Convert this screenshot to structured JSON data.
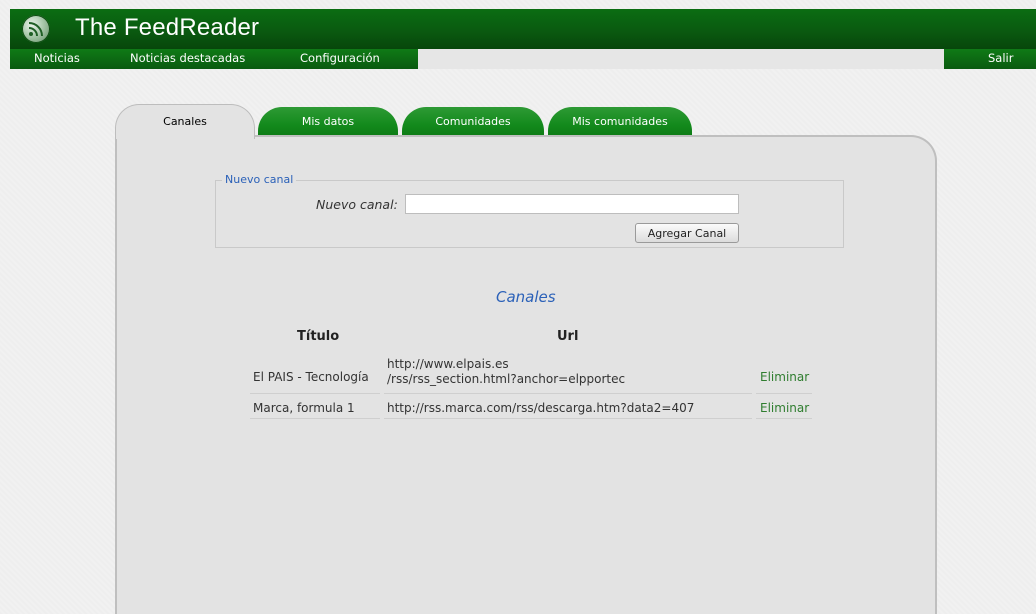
{
  "app": {
    "title": "The FeedReader",
    "logo_icon": "rss-icon"
  },
  "nav": {
    "items": [
      "Noticias",
      "Noticias destacadas",
      "Configuración"
    ],
    "logout": "Salir"
  },
  "tabs": [
    {
      "label": "Canales",
      "active": true
    },
    {
      "label": "Mis datos",
      "active": false
    },
    {
      "label": "Comunidades",
      "active": false
    },
    {
      "label": "Mis comunidades",
      "active": false
    }
  ],
  "form": {
    "legend": "Nuevo canal",
    "field_label": "Nuevo canal:",
    "field_value": "",
    "button_label": "Agregar Canal"
  },
  "channels": {
    "title": "Canales",
    "columns": [
      "Título",
      "Url"
    ],
    "rows": [
      {
        "title": "El PAIS - Tecnología",
        "url_line1": "http://www.elpais.es",
        "url_line2": "/rss/rss_section.html?anchor=elpportec",
        "action": "Eliminar"
      },
      {
        "title": "Marca, formula 1",
        "url_line1": "http://rss.marca.com/rss/descarga.htm?data2=407",
        "url_line2": "",
        "action": "Eliminar"
      }
    ]
  },
  "colors": {
    "header_green": "#0a5a10",
    "tab_green": "#138a1c",
    "accent_blue": "#2b61b8",
    "link_green": "#2f7d2f"
  }
}
